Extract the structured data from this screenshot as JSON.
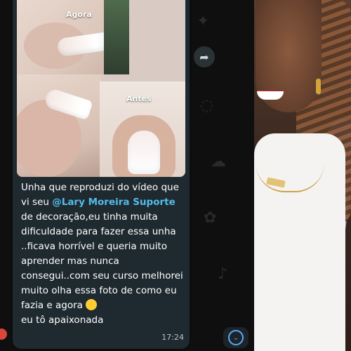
{
  "message": {
    "captions": {
      "after": "Agora",
      "before": "Antes"
    },
    "text_before_mention": "Unha que reproduzi do vídeo que vi seu ",
    "mention": "@Lary Moreira Suporte",
    "text_after_mention": " de decoração,eu tinha muita dificuldade para fazer essa unha ..ficava horrível e queria muito aprender mas nunca consegui..com seu curso melhorei muito olha essa foto de como eu fazia e agora",
    "text_end": "eu tô apaixonada",
    "time": "17:24"
  },
  "icons": {
    "forward": "share-forward-icon",
    "scroll": "chevron-down-icon",
    "emoji": "heart-eyes-emoji"
  },
  "colors": {
    "bubble": "#1f2a30",
    "mention": "#53bdeb",
    "scroll_accent": "#5aa7ff"
  }
}
